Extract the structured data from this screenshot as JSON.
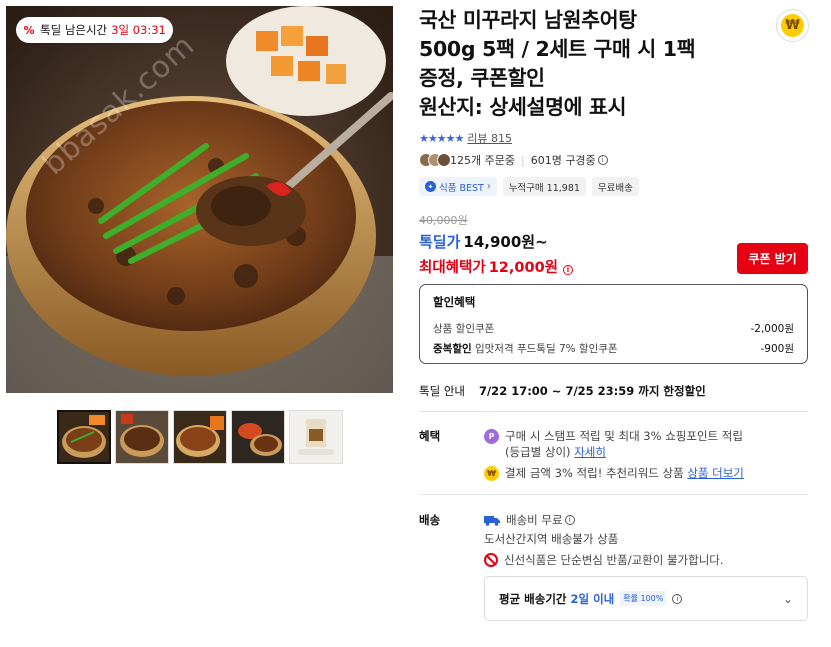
{
  "badge": {
    "label": "톡딜 남은시간",
    "time": "3일 03:31"
  },
  "watermark": "bbasak.com",
  "product": {
    "title_lines": [
      "국산 미꾸라지 남원추어탕",
      "500g 5팩 / 2세트 구매 시 1팩",
      "증정, 쿠폰할인",
      "원산지: 상세설명에 표시"
    ],
    "review_label": "리뷰 815",
    "rating": 5,
    "order_count": "125개 주문중",
    "viewers": "601명 구경중"
  },
  "tags": [
    "식품 BEST",
    "누적구매 11,981",
    "무료배송"
  ],
  "price": {
    "original": "40,000원",
    "deal_label": "톡딜가",
    "deal_value": "14,900원~",
    "max_label": "최대혜택가",
    "max_value": "12,000원",
    "coupon_button": "쿠폰 받기"
  },
  "discount_box": {
    "heading": "할인혜택",
    "rows": [
      {
        "label_bold": "",
        "label": "상품 할인쿠폰",
        "amount": "-2,000원"
      },
      {
        "label_bold": "중복할인",
        "label": "입맛저격 푸드톡딜 7% 할인쿠폰",
        "amount": "-900원"
      }
    ]
  },
  "deal_info": {
    "label": "톡딜 안내",
    "value": "7/22 17:00 ~ 7/25 23:59 까지 한정할인"
  },
  "benefits": {
    "label": "혜택",
    "line1": "구매 시 스탬프 적립 및 최대 3% 쇼핑포인트 적립",
    "line1b": "(등급별 상이)",
    "line1_link": "자세히",
    "line2": "결제 금액 3% 적립! 추천리워드 상품",
    "line2_link": "상품 더보기"
  },
  "shipping": {
    "label": "배송",
    "fee": "배송비 무료",
    "restriction": "도서산간지역 배송불가 상품",
    "notice": "신선식품은 단순변심 반품/교환이 불가합니다.",
    "avg_label": "평균 배송기간",
    "avg_days": "2일 이내",
    "avg_rate": "확률 100%"
  },
  "colors": {
    "accent_red": "#e60012",
    "accent_blue": "#2a62d6",
    "star": "#3866d9"
  }
}
